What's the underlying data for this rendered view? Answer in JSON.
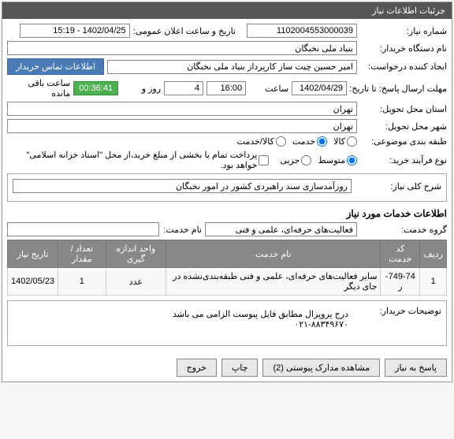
{
  "panel": {
    "title": "جزئیات اطلاعات نیاز"
  },
  "fields": {
    "need_number_label": "شماره نیاز:",
    "need_number_value": "1102004553000039",
    "announce_date_label": "تاریخ و ساعت اعلان عمومی:",
    "announce_date_value": "1402/04/25 - 15:19",
    "buyer_org_label": "نام دستگاه خریدار:",
    "buyer_org_value": "بنیاد ملی نخبگان",
    "requester_label": "ایجاد کننده درخواست:",
    "requester_value": "امیر حسین چیت ساز کارپرداز بنیاد ملی نخبگان",
    "contact_info_btn": "اطلاعات تماس خریدار",
    "deadline_label": "مهلت ارسال پاسخ: تا تاریخ:",
    "deadline_date": "1402/04/29",
    "hour_label": "ساعت",
    "deadline_hour": "16:00",
    "day_label": "روز و",
    "deadline_days": "4",
    "remaining_label": "ساعت باقی مانده",
    "remaining_time": "00:36:41",
    "delivery_province_label": "استان محل تحویل:",
    "delivery_province_value": "تهران",
    "delivery_city_label": "شهر محل تحویل:",
    "delivery_city_value": "تهران",
    "subject_class_label": "طبقه بندی موضوعی:",
    "radio_goods": "کالا",
    "radio_service": "خدمت",
    "radio_goods_service": "کالا/خدمت",
    "process_type_label": "نوع فرآیند خرید:",
    "radio_medium": "متوسط",
    "radio_partial": "جزیی",
    "payment_note": "پرداخت تمام یا بخشی از مبلغ خرید،از محل \"اسناد خزانه اسلامی\" خواهد بود.",
    "overall_desc_label": "شرح کلی نیاز:",
    "overall_desc_value": "روزآمدسازی سند راهبردی کشور در امور نخبگان",
    "services_title": "اطلاعات خدمات مورد نیاز",
    "service_group_label": "گروه خدمت:",
    "service_group_value": "فعالیت‌های حرفه‌ای، علمی و فنی",
    "buyer_notes_label": "توضیحات خریدار:",
    "buyer_notes_value": "درج پروپزال مطابق فایل پیوست الزامی می باشد\n۰۲۱-۸۸۳۴۹۶۷۰",
    "page_title_label": "نام خدمت:"
  },
  "table": {
    "headers": {
      "row": "ردیف",
      "code": "کد خدمت",
      "name": "نام خدمت",
      "unit": "واحد اندازه گیری",
      "qty": "تعداد / مقدار",
      "date": "تاریخ نیاز"
    },
    "rows": [
      {
        "row": "1",
        "code": "749-74-ر",
        "name": "سایر فعالیت‌های حرفه‌ای، علمی و فنی طبقه‌بندی‌نشده در جای دیگر",
        "unit": "عدد",
        "qty": "1",
        "date": "1402/05/23"
      }
    ]
  },
  "buttons": {
    "respond": "پاسخ به نیاز",
    "attachments": "مشاهده مدارک پیوستی (2)",
    "print": "چاپ",
    "exit": "خروج"
  }
}
